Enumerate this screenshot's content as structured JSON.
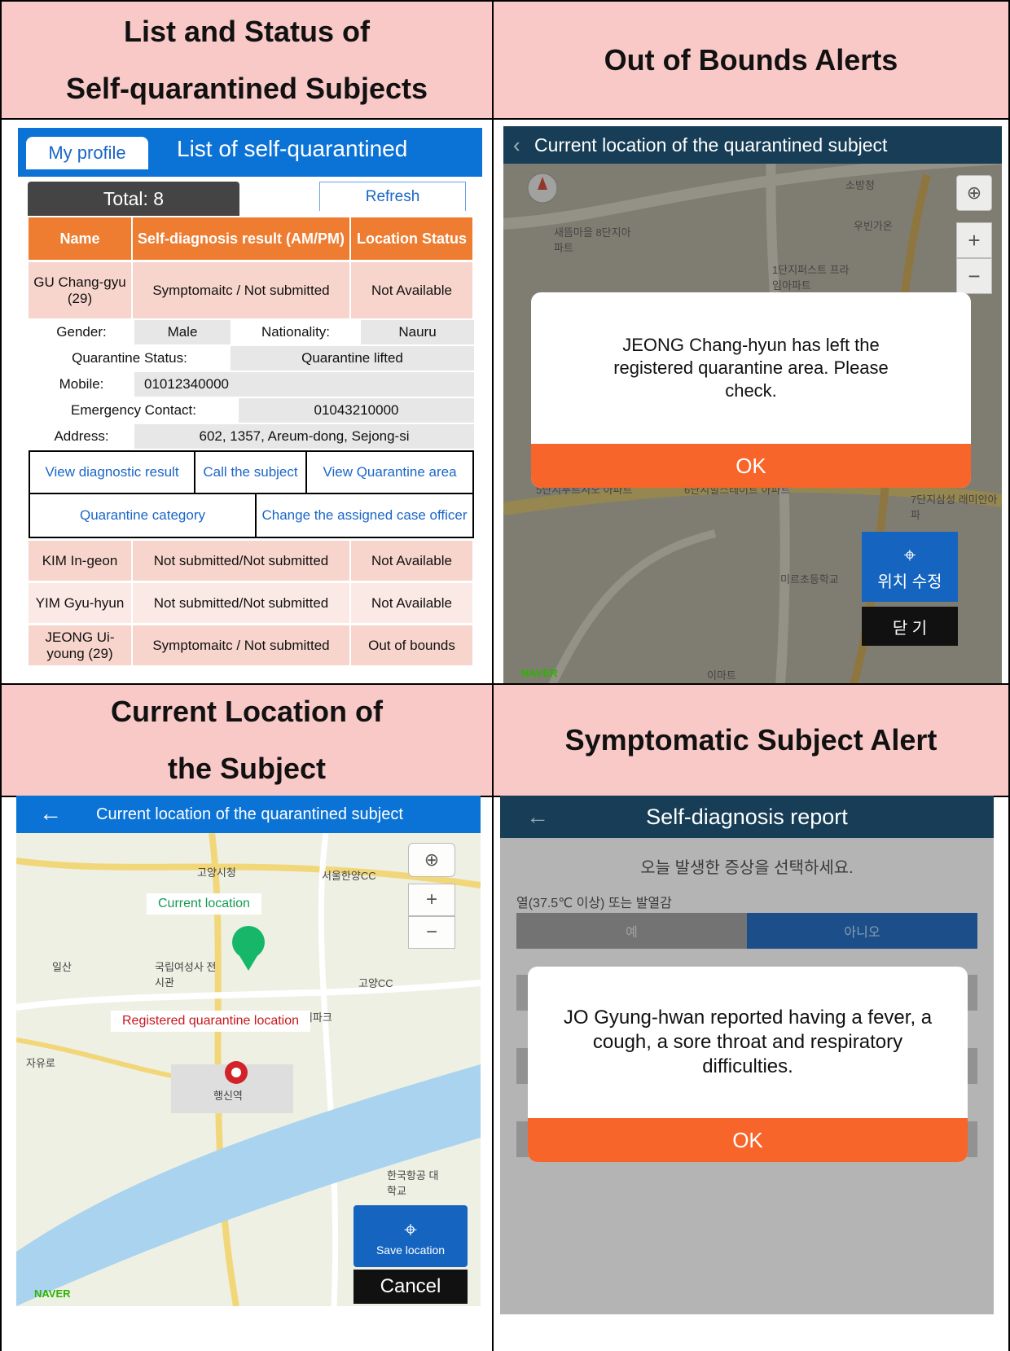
{
  "headers": {
    "list_status": [
      "List and Status of",
      "Self-quarantined Subjects"
    ],
    "out_of_bounds": "Out of Bounds Alerts",
    "current_location": [
      "Current Location of",
      "the Subject"
    ],
    "symptomatic": "Symptomatic Subject Alert"
  },
  "list_panel": {
    "my_profile": "My profile",
    "title": "List of self-quarantined",
    "total": "Total: 8",
    "refresh": "Refresh",
    "columns": [
      "Name",
      "Self-diagnosis result (AM/PM)",
      "Location Status"
    ],
    "first_row": {
      "name": "GU Chang-gyu (29)",
      "result": "Symptomaitc / Not submitted",
      "location": "Not Available"
    },
    "details": {
      "gender_label": "Gender:",
      "gender": "Male",
      "nationality_label": "Nationality:",
      "nationality": "Nauru",
      "quarantine_label": "Quarantine Status:",
      "quarantine": "Quarantine lifted",
      "mobile_label": "Mobile:",
      "mobile": "01012340000",
      "emergency_label": "Emergency Contact:",
      "emergency": "01043210000",
      "address_label": "Address:",
      "address": "602, 1357, Areum-dong, Sejong-si"
    },
    "actions": {
      "view_diag": "View diagnostic result",
      "call": "Call the subject",
      "view_area": "View Quarantine area",
      "category": "Quarantine category",
      "change_officer": "Change the assigned case officer"
    },
    "rows": [
      {
        "name": "KIM In-geon",
        "result": "Not submitted/Not submitted",
        "location": "Not Available"
      },
      {
        "name": "YIM Gyu-hyun",
        "result": "Not submitted/Not submitted",
        "location": "Not Available"
      },
      {
        "name": "JEONG Ui-young (29)",
        "result": "Symptomaitc / Not submitted",
        "location": "Out of bounds"
      }
    ]
  },
  "oob_panel": {
    "title": "Current location of the quarantined subject",
    "message": "JEONG Chang-hyun has left the registered quarantine area. Please check.",
    "ok": "OK",
    "relocate": "위치 수정",
    "close": "닫 기",
    "map_labels": [
      "소방청",
      "우빈가온",
      "새뜸마을 8단지아파트",
      "1단지퍼스트 프라임아파트",
      "5단지푸르지오 아파트",
      "6단지힐스테이트 아파트",
      "7단지삼성 래미안아파",
      "미르초등학교",
      "이마트",
      "NAVER"
    ]
  },
  "location_panel": {
    "title": "Current location of the quarantined subject",
    "current_label": "Current location",
    "registered_label": "Registered quarantine location",
    "save": "Save location",
    "cancel": "Cancel",
    "map_labels": [
      "고양시청",
      "서울한양CC",
      "일산",
      "국립여성사 전시관",
      "고양CC",
      "워터파크",
      "자유로",
      "행신역",
      "한국항공 대학교",
      "NAVER"
    ]
  },
  "diag_panel": {
    "title": "Self-diagnosis report",
    "prompt": "오늘 발생한 증상을 선택하세요.",
    "q1": "열(37.5℃ 이상) 또는 발열감",
    "yes": "예",
    "no": "아니오",
    "message": "JO Gyung-hwan reported having a fever, a cough, a sore throat and respiratory difficulties.",
    "ok": "OK"
  }
}
